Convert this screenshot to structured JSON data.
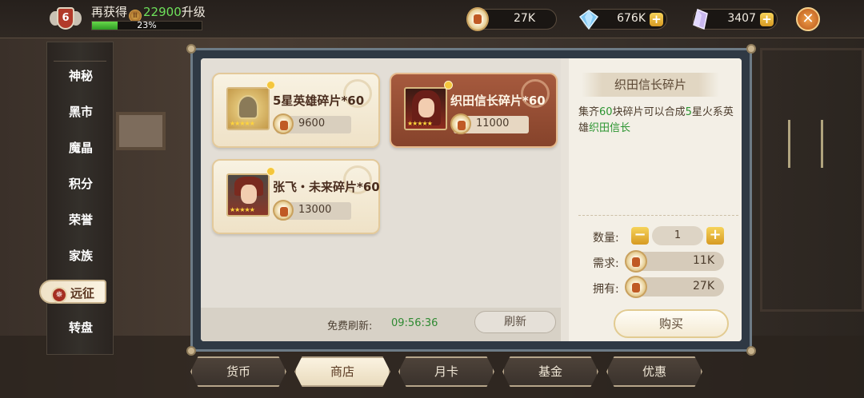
{
  "topbar": {
    "level": "6",
    "exp_prefix": "再获得",
    "exp_amount": "22900",
    "exp_suffix": "升级",
    "exp_progress_pct": 23,
    "exp_pct_label": "23%",
    "currency_gold": "27K",
    "currency_diamond": "676K",
    "currency_crystal": "3407",
    "icons": [
      "level-badge-icon",
      "exp-token-icon",
      "coin-icon",
      "diamond-icon",
      "crystal-icon",
      "plus-icon",
      "close-icon"
    ]
  },
  "sidebar": {
    "items": [
      {
        "label": "神秘",
        "active": false
      },
      {
        "label": "黑市",
        "active": false
      },
      {
        "label": "魔晶",
        "active": false
      },
      {
        "label": "积分",
        "active": false
      },
      {
        "label": "荣誉",
        "active": false
      },
      {
        "label": "家族",
        "active": false
      },
      {
        "label": "远征",
        "active": true
      },
      {
        "label": "转盘",
        "active": false
      }
    ]
  },
  "shop": {
    "items": [
      {
        "title": "5星英雄碎片*60",
        "price": "9600",
        "selected": false,
        "icon": "helmet-icon"
      },
      {
        "title": "织田信长碎片*60",
        "price": "11000",
        "selected": true,
        "icon": "hero-portrait-icon"
      },
      {
        "title": "张飞・未来碎片*60",
        "price": "13000",
        "selected": false,
        "icon": "hero-portrait-icon"
      }
    ],
    "refresh_label": "免费刷新:",
    "refresh_time": "09:56:36",
    "refresh_button": "刷新"
  },
  "detail": {
    "title": "织田信长碎片",
    "desc_1": "集齐",
    "desc_num": "60",
    "desc_2": "块碎片可以合成",
    "desc_star": "5",
    "desc_3": "星火系英雄",
    "desc_hero": "织田信长",
    "qty_label": "数量:",
    "qty_value": "1",
    "need_label": "需求:",
    "need_value": "11K",
    "own_label": "拥有:",
    "own_value": "27K",
    "buy_button": "购买"
  },
  "bottom_tabs": [
    {
      "label": "货币",
      "active": false
    },
    {
      "label": "商店",
      "active": true
    },
    {
      "label": "月卡",
      "active": false
    },
    {
      "label": "基金",
      "active": false
    },
    {
      "label": "优惠",
      "active": false
    }
  ],
  "colors": {
    "exp_green": "#6ee05b",
    "refresh_green": "#2f8a32",
    "selected_card": "#a65a3e",
    "gold_button": "#d79a22"
  }
}
